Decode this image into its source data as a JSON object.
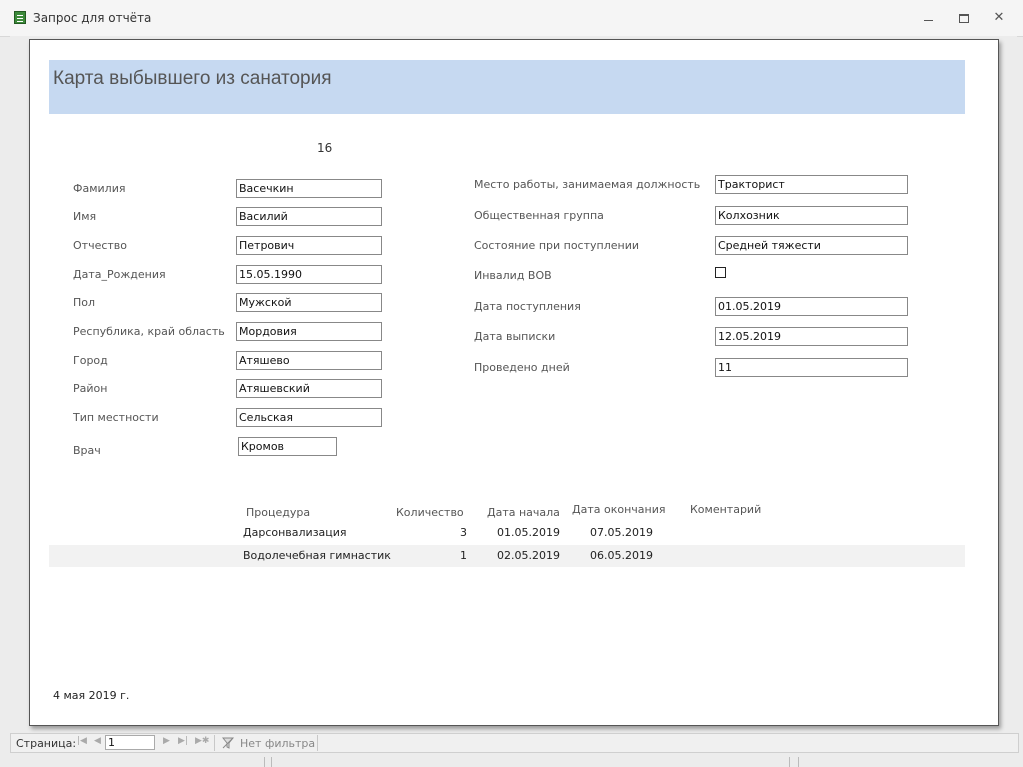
{
  "window": {
    "title": "Запрос для отчёта",
    "min_icon": "minimize-icon",
    "max_icon": "restore-icon",
    "close_icon": "close-icon"
  },
  "report": {
    "title": "Карта выбывшего из санатория",
    "record_id": "16",
    "header_color": "#c6d9f1",
    "left_fields": [
      {
        "label": "Фамилия",
        "value": "Васечкин"
      },
      {
        "label": "Имя",
        "value": "Василий"
      },
      {
        "label": "Отчество",
        "value": "Петрович"
      },
      {
        "label": "Дата_Рождения",
        "value": "15.05.1990"
      },
      {
        "label": "Пол",
        "value": "Мужской"
      },
      {
        "label": "Республика, край область",
        "value": "Мордовия"
      },
      {
        "label": "Город",
        "value": "Атяшево"
      },
      {
        "label": "Район",
        "value": "Атяшевский"
      },
      {
        "label": "Тип местности",
        "value": "Сельская"
      },
      {
        "label": "Врач",
        "value": "Кромов"
      }
    ],
    "right_fields": [
      {
        "label": "Место работы, занимаемая должность",
        "value": "Тракторист"
      },
      {
        "label": "Общественная группа",
        "value": "Колхозник"
      },
      {
        "label": "Состояние при поступлении",
        "value": "Средней тяжести"
      },
      {
        "label": "Инвалид ВОВ",
        "checked": false
      },
      {
        "label": "Дата поступления",
        "value": "01.05.2019"
      },
      {
        "label": "Дата выписки",
        "value": "12.05.2019"
      },
      {
        "label": "Проведено дней",
        "value": "11"
      }
    ],
    "procedures": {
      "headers": [
        "Процедура",
        "Количество",
        "Дата начала",
        "Дата окончания",
        "Коментарий"
      ],
      "rows": [
        {
          "procedure": "Дарсонвализация",
          "count": "3",
          "start": "01.05.2019",
          "end": "07.05.2019",
          "comment": ""
        },
        {
          "procedure": "Водолечебная гимнастик",
          "count": "1",
          "start": "02.05.2019",
          "end": "06.05.2019",
          "comment": ""
        }
      ]
    },
    "footer_date": "4 мая 2019 г."
  },
  "navigation": {
    "page_label": "Страница:",
    "page_value": "1",
    "filter_label": "Нет фильтра",
    "first_icon": "first-record-icon",
    "prev_icon": "prev-record-icon",
    "next_icon": "next-record-icon",
    "last_icon": "last-record-icon",
    "filter_icon": "filter-off-icon"
  }
}
